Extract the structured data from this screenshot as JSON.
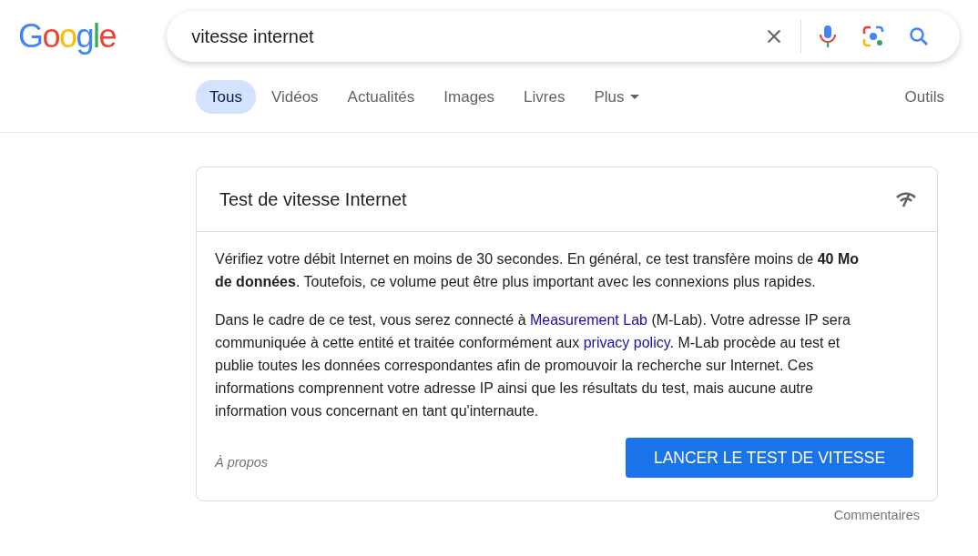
{
  "logo": "Google",
  "search": {
    "value": "vitesse internet"
  },
  "tabs": [
    {
      "label": "Tous",
      "selected": true
    },
    {
      "label": "Vidéos",
      "selected": false
    },
    {
      "label": "Actualités",
      "selected": false
    },
    {
      "label": "Images",
      "selected": false
    },
    {
      "label": "Livres",
      "selected": false
    },
    {
      "label": "Plus",
      "selected": false,
      "dropdown": true
    }
  ],
  "tools": "Outils",
  "card": {
    "title": "Test de vitesse Internet",
    "paragraphs": [
      [
        {
          "text": "Vérifiez votre débit Internet en moins de 30 secondes. En général, ce test transfère moins de **40 Mo de données**. Toutefois, ce volume peut être plus important avec les connexions plus rapides."
        }
      ],
      [
        {
          "text": "Dans le cadre de ce test, vous serez connecté à "
        },
        {
          "text": "Measurement Lab",
          "link": true
        },
        {
          "text": " (M-Lab). Votre adresse IP sera communiquée à cette entité et traitée conformément aux "
        },
        {
          "text": "privacy policy",
          "link": true
        },
        {
          "text": ". M-Lab procède au test et publie toutes les données correspondantes afin de promouvoir la recherche sur Internet. Ces informations comprennent votre adresse IP ainsi que les résultats du test, mais aucune autre information vous concernant en tant qu'internaute."
        }
      ]
    ],
    "about": "À propos",
    "button": "LANCER LE TEST DE VITESSE"
  },
  "feedback": "Commentaires"
}
